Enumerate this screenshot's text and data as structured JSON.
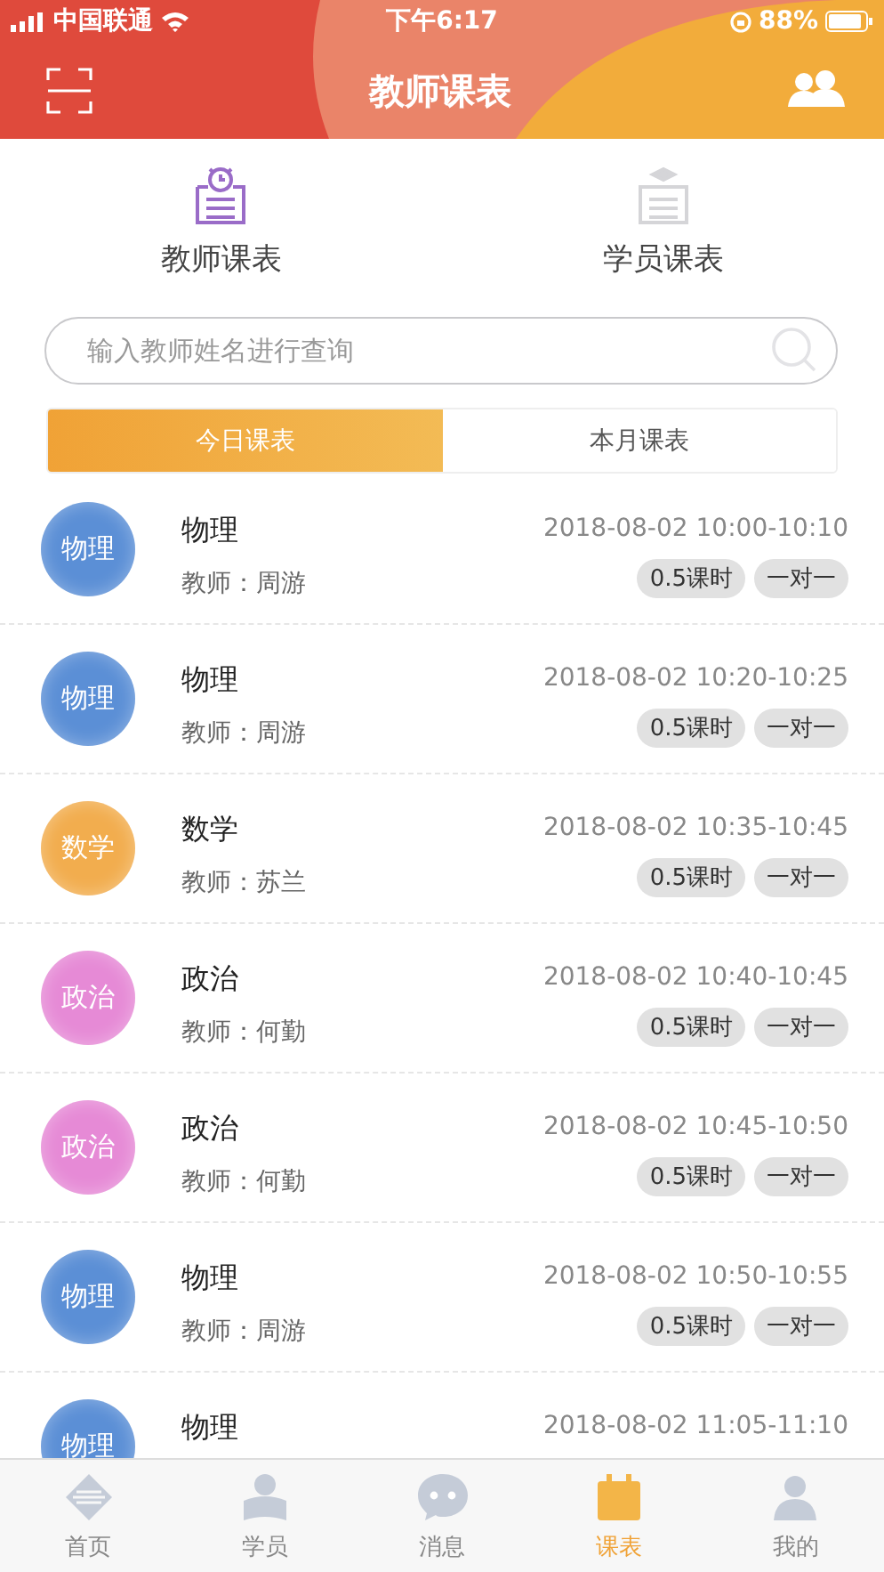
{
  "status_bar": {
    "carrier": "中国联通",
    "time": "下午6:17",
    "battery": "88%"
  },
  "header": {
    "title": "教师课表"
  },
  "views": [
    {
      "label": "教师课表",
      "selected": true
    },
    {
      "label": "学员课表",
      "selected": false
    }
  ],
  "search": {
    "placeholder": "输入教师姓名进行查询"
  },
  "tabs": [
    {
      "label": "今日课表",
      "selected": true
    },
    {
      "label": "本月课表",
      "selected": false
    }
  ],
  "lessons": [
    {
      "badge": "物理",
      "color": "#5b8fd6",
      "subject": "物理",
      "teacher": "教师：周游",
      "time": "2018-08-02 10:00-10:10",
      "tags": [
        "0.5课时",
        "一对一"
      ]
    },
    {
      "badge": "物理",
      "color": "#5b8fd6",
      "subject": "物理",
      "teacher": "教师：周游",
      "time": "2018-08-02 10:20-10:25",
      "tags": [
        "0.5课时",
        "一对一"
      ]
    },
    {
      "badge": "数学",
      "color": "#f2ad4e",
      "subject": "数学",
      "teacher": "教师：苏兰",
      "time": "2018-08-02 10:35-10:45",
      "tags": [
        "0.5课时",
        "一对一"
      ]
    },
    {
      "badge": "政治",
      "color": "#e68ad6",
      "subject": "政治",
      "teacher": "教师：何勤",
      "time": "2018-08-02 10:40-10:45",
      "tags": [
        "0.5课时",
        "一对一"
      ]
    },
    {
      "badge": "政治",
      "color": "#e68ad6",
      "subject": "政治",
      "teacher": "教师：何勤",
      "time": "2018-08-02 10:45-10:50",
      "tags": [
        "0.5课时",
        "一对一"
      ]
    },
    {
      "badge": "物理",
      "color": "#5b8fd6",
      "subject": "物理",
      "teacher": "教师：周游",
      "time": "2018-08-02 10:50-10:55",
      "tags": [
        "0.5课时",
        "一对一"
      ]
    },
    {
      "badge": "物理",
      "color": "#5b8fd6",
      "subject": "物理",
      "time": "2018-08-02 11:05-11:10"
    }
  ],
  "nav": [
    {
      "kind": "home",
      "label": "首页",
      "selected": false
    },
    {
      "kind": "student",
      "label": "学员",
      "selected": false
    },
    {
      "kind": "message",
      "label": "消息",
      "selected": false
    },
    {
      "kind": "schedule",
      "label": "课表",
      "selected": true
    },
    {
      "kind": "me",
      "label": "我的",
      "selected": false
    }
  ]
}
